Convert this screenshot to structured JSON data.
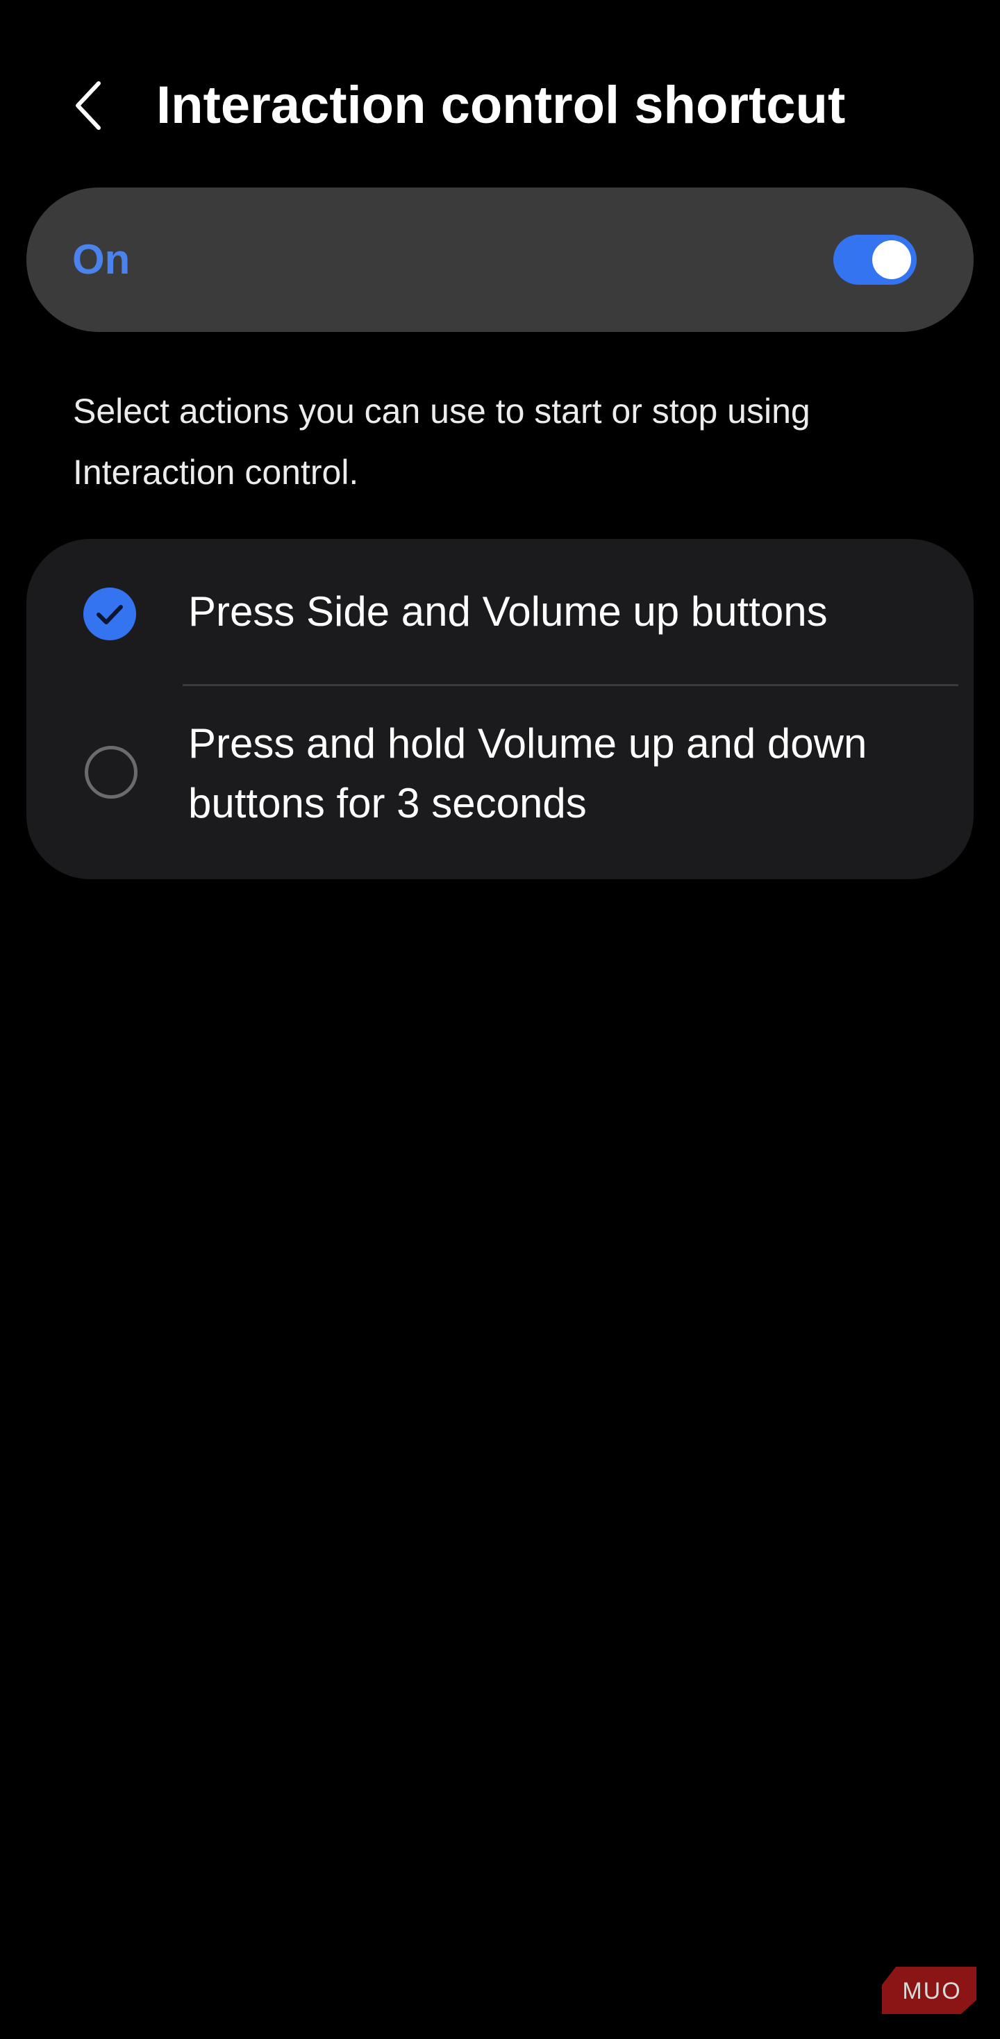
{
  "header": {
    "title": "Interaction control shortcut"
  },
  "master_switch": {
    "label": "On",
    "state": "on",
    "accent_color": "#3574f0"
  },
  "description": "Select actions you can use to start or stop using Interaction control.",
  "options": [
    {
      "label": "Press Side and Volume up buttons",
      "checked": true
    },
    {
      "label": "Press and hold Volume up and down buttons for 3 seconds",
      "checked": false
    }
  ],
  "watermark": {
    "text": "MUO",
    "color": "#8b1414"
  },
  "icons": {
    "back": "chevron-left-icon",
    "checked": "check-circle-icon",
    "unchecked": "empty-circle-icon"
  }
}
